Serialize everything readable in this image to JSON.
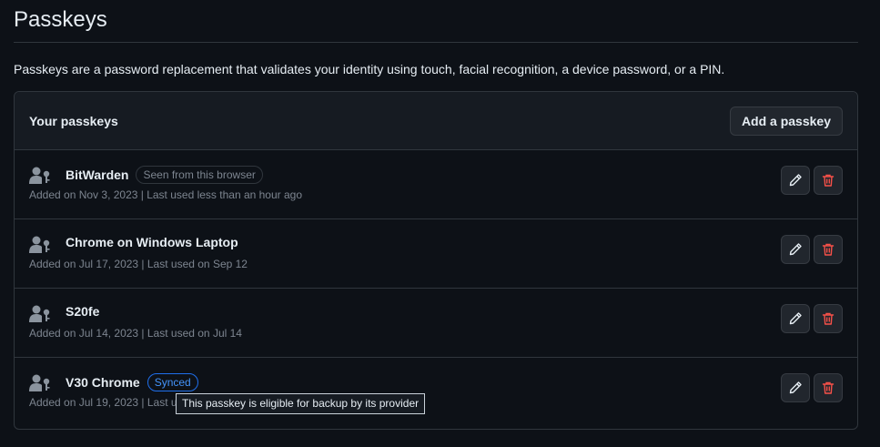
{
  "page": {
    "title": "Passkeys",
    "description": "Passkeys are a password replacement that validates your identity using touch, facial recognition, a device password, or a PIN."
  },
  "panel": {
    "title": "Your passkeys",
    "add_button_label": "Add a passkey"
  },
  "passkeys": [
    {
      "name": "BitWarden",
      "badge": "Seen from this browser",
      "meta": "Added on Nov 3, 2023 | Last used less than an hour ago"
    },
    {
      "name": "Chrome on Windows Laptop",
      "meta": "Added on Jul 17, 2023 | Last used on Sep 12"
    },
    {
      "name": "S20fe",
      "meta": "Added on Jul 14, 2023 | Last used on Jul 14"
    },
    {
      "name": "V30 Chrome",
      "badge": "Synced",
      "meta": "Added on Jul 19, 2023 | Last used on Jul 19"
    }
  ],
  "tooltip": {
    "text": "This passkey is eligible for backup by its provider"
  },
  "icons": {
    "row_icon": "passkey-person-icon",
    "edit": "pencil-icon",
    "delete": "trash-icon"
  },
  "colors": {
    "background": "#0d1117",
    "border": "#30363d",
    "accent": "#4493f8",
    "danger": "#f85149",
    "muted": "#7d8590"
  }
}
